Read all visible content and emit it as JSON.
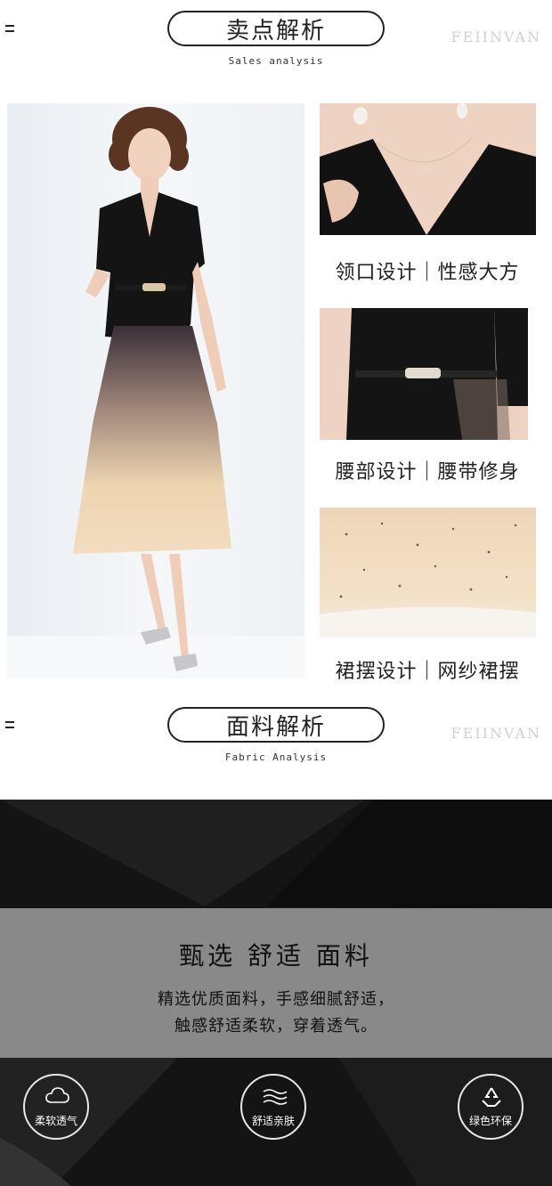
{
  "section1": {
    "title": "卖点解析",
    "subtitle": "Sales analysis",
    "brand": "FEIINVAN"
  },
  "captions": {
    "neckline": "领口设计｜性感大方",
    "waist": "腰部设计｜腰带修身",
    "hem": "裙摆设计｜网纱裙摆"
  },
  "section2": {
    "title": "面料解析",
    "subtitle": "Fabric Analysis",
    "brand": "FEIINVAN"
  },
  "fabric": {
    "headline": "甄选 舒适 面料",
    "line1": "精选优质面料，手感细腻舒适，",
    "line2": "触感舒适柔软，穿着透气。"
  },
  "features": [
    {
      "label": "柔软透气",
      "icon": "cloud-icon"
    },
    {
      "label": "舒适亲肤",
      "icon": "waves-icon"
    },
    {
      "label": "绿色环保",
      "icon": "recycle-icon"
    }
  ],
  "colors": {
    "ink": "#222222",
    "dress_black": "#111111",
    "tulle": "#e8d2b0",
    "band": "#aaaaaa"
  }
}
